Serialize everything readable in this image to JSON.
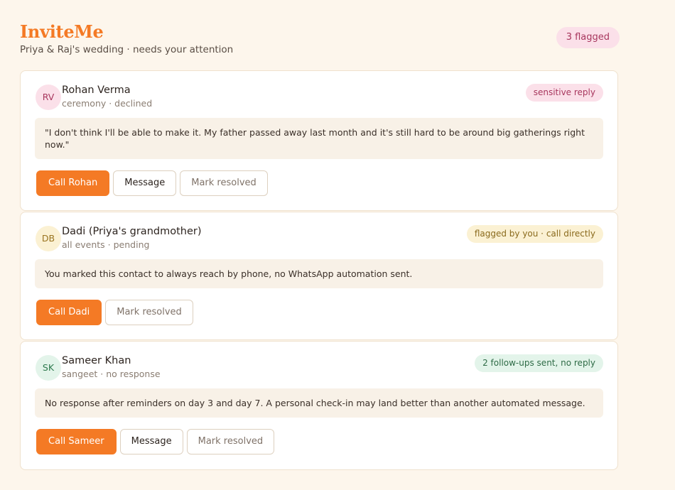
{
  "app": {
    "brand": "InviteMe",
    "subtitle": "Priya & Raj's wedding · needs your attention",
    "flagged_count": "3 flagged"
  },
  "colors": {
    "accent": "#f47a25",
    "page_bg": "#fdf6ec",
    "sensitive_tag": "#fbe0e9",
    "flagged_tag": "#fbf1d3",
    "followup_tag": "#e3f4ea"
  },
  "guests": [
    {
      "initials": "RV",
      "name": "Rohan Verma",
      "meta": "ceremony · declined",
      "tag": "sensitive reply",
      "note": "\"I don't think I'll be able to make it. My father passed away last month and it's still hard to be around big gatherings right now.\"",
      "call_label": "Call Rohan",
      "message_label": "Message",
      "resolve_label": "Mark resolved"
    },
    {
      "initials": "DB",
      "name": "Dadi (Priya's grandmother)",
      "meta": "all events · pending",
      "tag": "flagged by you · call directly",
      "note": "You marked this contact to always reach by phone, no WhatsApp automation sent.",
      "call_label": "Call Dadi",
      "resolve_label": "Mark resolved"
    },
    {
      "initials": "SK",
      "name": "Sameer Khan",
      "meta": "sangeet · no response",
      "tag": "2 follow-ups sent, no reply",
      "note": "No response after reminders on day 3 and day 7. A personal check-in may land better than another automated message.",
      "call_label": "Call Sameer",
      "message_label": "Message",
      "resolve_label": "Mark resolved"
    }
  ]
}
